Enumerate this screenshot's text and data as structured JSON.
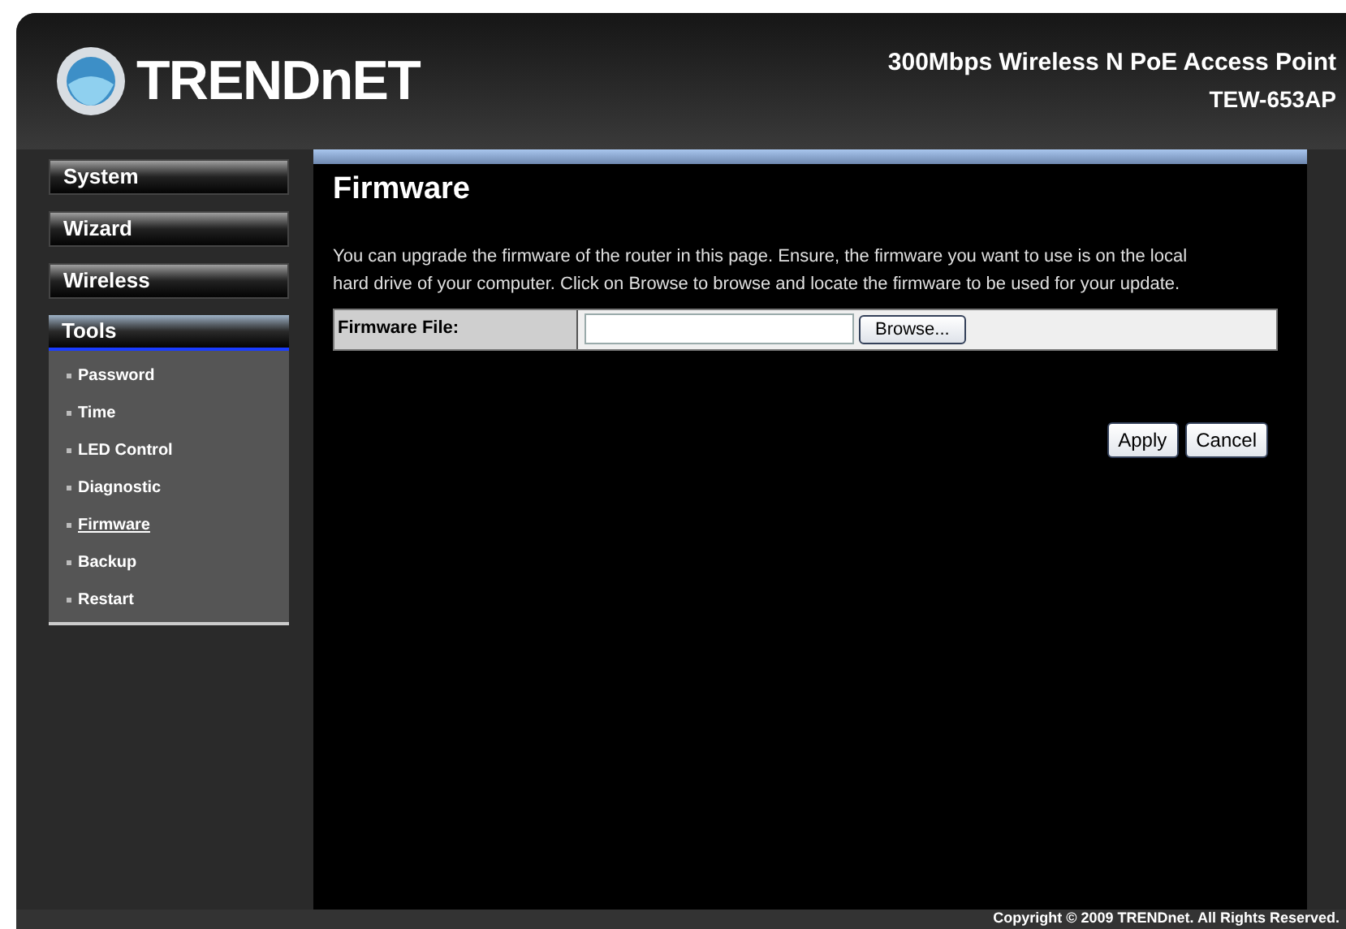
{
  "header": {
    "logo": "TRENDnET",
    "product": "300Mbps Wireless N PoE Access Point",
    "model": "TEW-653AP"
  },
  "menu": [
    {
      "label": "System",
      "selected": false
    },
    {
      "label": "Wizard",
      "selected": false
    },
    {
      "label": "Wireless",
      "selected": false
    },
    {
      "label": "Tools",
      "selected": true,
      "children": [
        {
          "label": "Password",
          "selected": false
        },
        {
          "label": "Time",
          "selected": false
        },
        {
          "label": "LED Control",
          "selected": false
        },
        {
          "label": "Diagnostic",
          "selected": false
        },
        {
          "label": "Firmware",
          "selected": true
        },
        {
          "label": "Backup",
          "selected": false
        },
        {
          "label": "Restart",
          "selected": false
        }
      ]
    }
  ],
  "page": {
    "title": "Firmware",
    "description": "You can upgrade the firmware of the router in this page. Ensure, the firmware you want to use is on the local hard drive of your computer. Click on Browse to browse and locate the firmware to be used for your update.",
    "field_label": "Firmware File:",
    "browse": "Browse...",
    "buttons": [
      "Apply",
      "Cancel"
    ]
  },
  "footer": "Copyright © 2009 TRENDnet. All Rights Reserved."
}
